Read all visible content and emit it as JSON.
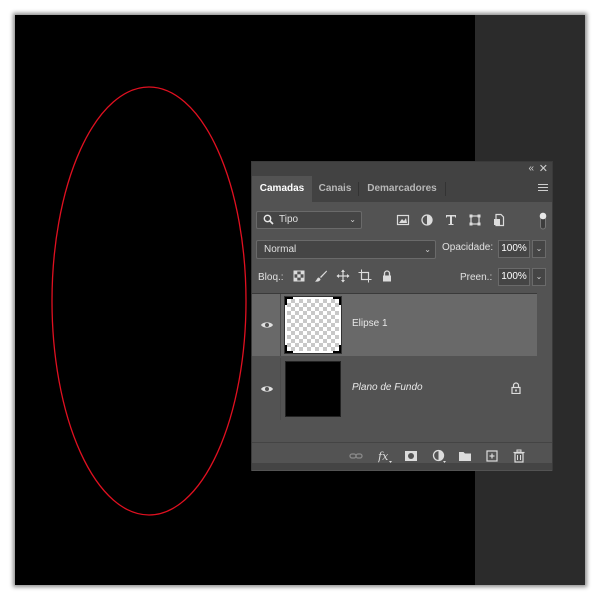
{
  "panel": {
    "tabs": [
      {
        "label": "Camadas",
        "active": true
      },
      {
        "label": "Canais",
        "active": false
      },
      {
        "label": "Demarcadores",
        "active": false
      }
    ],
    "filter": {
      "label": "Tipo"
    },
    "blend_mode": "Normal",
    "opacity_label": "Opacidade:",
    "opacity_value": "100%",
    "lock_label": "Bloq.:",
    "fill_label": "Preen.:",
    "fill_value": "100%",
    "layers": [
      {
        "name": "Elipse 1",
        "selected": true,
        "visible": true,
        "thumbnail": "transparent"
      },
      {
        "name": "Plano de Fundo",
        "selected": false,
        "visible": true,
        "thumbnail": "black",
        "locked": true
      }
    ]
  },
  "colors": {
    "canvas": "#000000",
    "ellipse_stroke": "#e01020",
    "panel_bg": "#535353",
    "selected_layer": "#696969",
    "workspace": "#2b2b2b"
  }
}
